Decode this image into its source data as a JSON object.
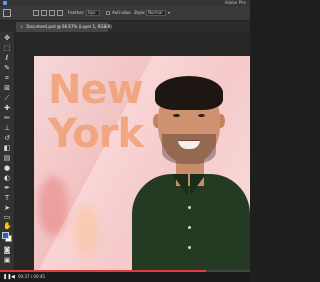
{
  "app": {
    "brand": "Adobe Pho"
  },
  "options_bar": {
    "feather_label": "Feather:",
    "feather_value": "0px",
    "anti_alias_label": "Anti-alias",
    "style_label": "Style:",
    "style_value": "Normal"
  },
  "document": {
    "tab_title": "Document.psd @ 66.67% (Layer 1, RGB/8)"
  },
  "tools": [
    "move-icon",
    "marquee-icon",
    "lasso-icon",
    "quick-select-icon",
    "crop-icon",
    "frame-icon",
    "eyedropper-icon",
    "healing-icon",
    "brush-icon",
    "stamp-icon",
    "history-brush-icon",
    "eraser-icon",
    "gradient-icon",
    "blur-icon",
    "dodge-icon",
    "pen-icon",
    "type-icon",
    "path-select-icon",
    "shape-icon",
    "hand-icon",
    "zoom-icon",
    "more-icon"
  ],
  "colors": {
    "foreground": "#1a66c2",
    "background": "#ffffff",
    "accent": "#e03a3a"
  },
  "canvas": {
    "headline_line1": "New",
    "headline_line2": "York"
  },
  "player": {
    "time": "00:37 / 00:45",
    "progress": 0.822
  }
}
